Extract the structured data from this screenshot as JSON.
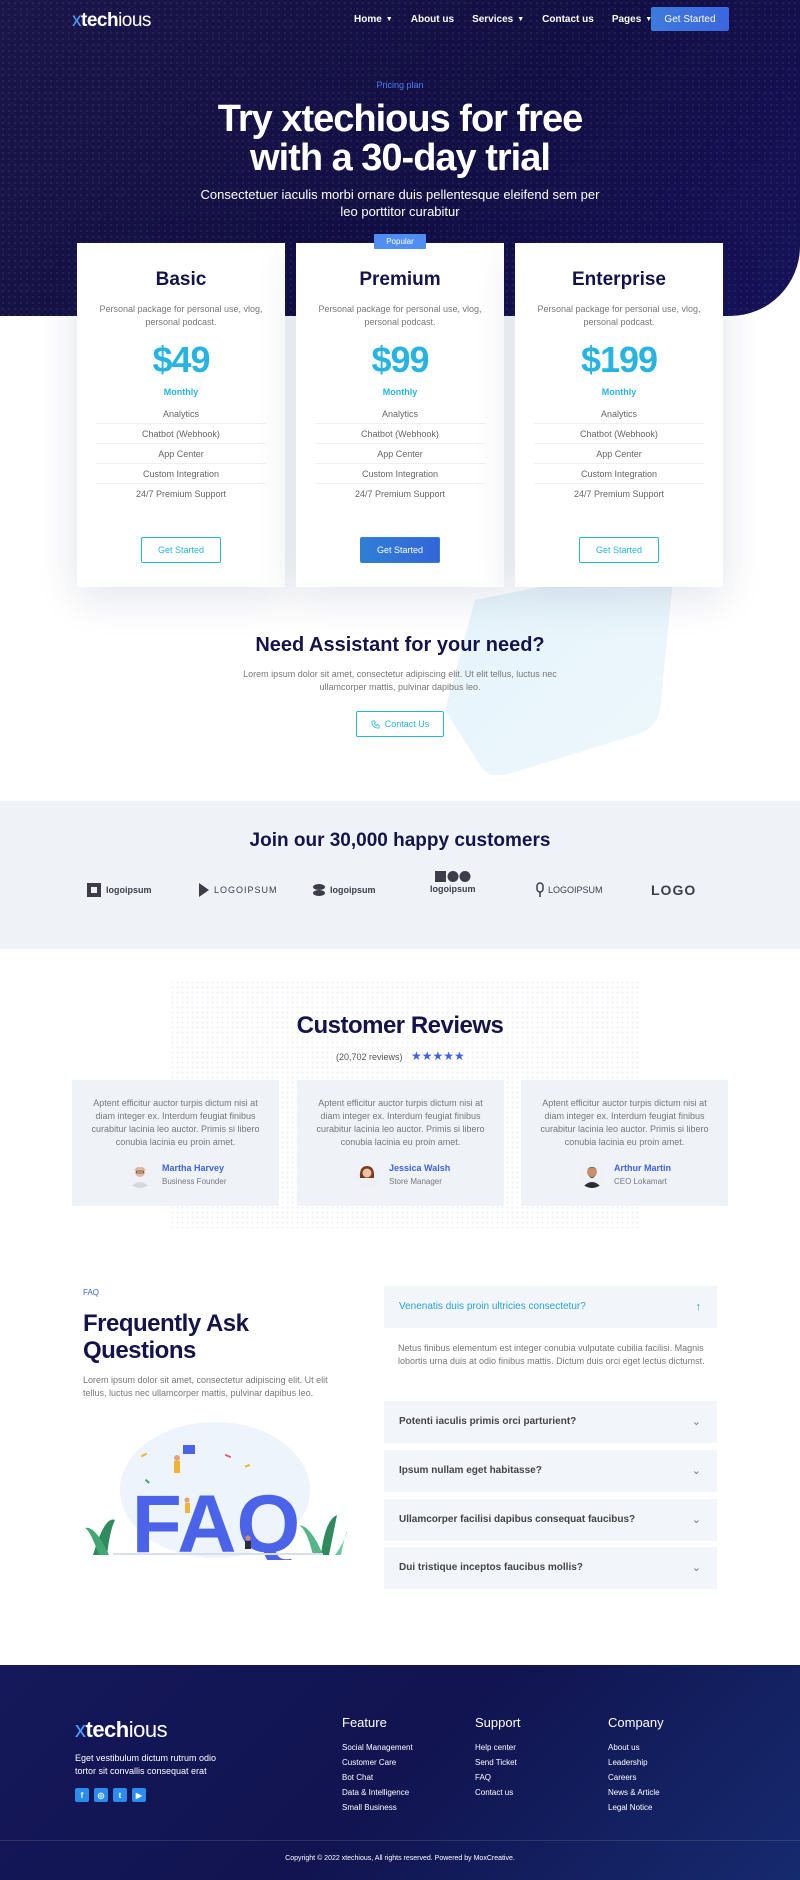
{
  "brand": {
    "x": "x",
    "bold": "tech",
    "regular": "ious"
  },
  "nav": {
    "items": [
      {
        "label": "Home",
        "dropdown": true
      },
      {
        "label": "About us",
        "dropdown": false
      },
      {
        "label": "Services",
        "dropdown": true
      },
      {
        "label": "Contact us",
        "dropdown": false
      },
      {
        "label": "Pages",
        "dropdown": true
      }
    ],
    "cta": "Get Started"
  },
  "hero": {
    "eyebrow": "Pricing plan",
    "title_line1": "Try xtechious for free",
    "title_line2": "with a 30-day trial",
    "subtitle": "Consectetuer iaculis morbi ornare duis pellentesque eleifend sem per leo porttitor curabitur"
  },
  "pricing": {
    "popular_badge": "Popular",
    "plans": [
      {
        "name": "Basic",
        "desc": "Personal package for personal use, vlog, personal podcast.",
        "price": "$49",
        "period": "Monthly",
        "features": [
          "Analytics",
          "Chatbot (Webhook)",
          "App Center",
          "Custom Integration",
          "24/7 Premium Support"
        ],
        "button": "Get Started",
        "highlighted": false
      },
      {
        "name": "Premium",
        "desc": "Personal package for personal use, vlog, personal podcast.",
        "price": "$99",
        "period": "Monthly",
        "features": [
          "Analytics",
          "Chatbot (Webhook)",
          "App Center",
          "Custom Integration",
          "24/7 Premium Support"
        ],
        "button": "Get Started",
        "highlighted": true
      },
      {
        "name": "Enterprise",
        "desc": "Personal package for personal use, vlog, personal podcast.",
        "price": "$199",
        "period": "Monthly",
        "features": [
          "Analytics",
          "Chatbot (Webhook)",
          "App Center",
          "Custom Integration",
          "24/7 Premium Support"
        ],
        "button": "Get Started",
        "highlighted": false
      }
    ]
  },
  "assistant": {
    "title": "Need Assistant for your need?",
    "text": "Lorem ipsum dolor sit amet, consectetur adipiscing elit. Ut elit tellus, luctus nec ullamcorper mattis, pulvinar dapibus leo.",
    "button": "Contact Us"
  },
  "customers": {
    "title": "Join our 30,000 happy customers",
    "logos": [
      "logoipsum",
      "LOGOIPSUM",
      "logoipsum",
      "logoipsum",
      "LOGOIPSUM",
      "LOGO"
    ]
  },
  "reviews": {
    "title": "Customer Reviews",
    "count": "(20,702 reviews)",
    "stars": "★★★★★",
    "items": [
      {
        "text": "Aptent efficitur auctor turpis dictum nisi at diam integer ex. Interdum feugiat finibus curabitur lacinia leo auctor. Primis si libero conubia lacinia eu proin amet.",
        "name": "Martha Harvey",
        "role": "Business Founder"
      },
      {
        "text": "Aptent efficitur auctor turpis dictum nisi at diam integer ex. Interdum feugiat finibus curabitur lacinia leo auctor. Primis si libero conubia lacinia eu proin amet.",
        "name": "Jessica Walsh",
        "role": "Store Manager"
      },
      {
        "text": "Aptent efficitur auctor turpis dictum nisi at diam integer ex. Interdum feugiat finibus curabitur lacinia leo auctor. Primis si libero conubia lacinia eu proin amet.",
        "name": "Arthur Martin",
        "role": "CEO Lokamart"
      }
    ]
  },
  "faq": {
    "eyebrow": "FAQ",
    "title": "Frequently Ask Questions",
    "text": "Lorem ipsum dolor sit amet, consectetur adipiscing elit. Ut elit tellus, luctus nec ullamcorper mattis, pulvinar dapibus leo.",
    "illustration_text": "FAQ",
    "items": [
      {
        "q": "Venenatis duis proin ultricies consectetur?",
        "open": true,
        "a": "Netus finibus elementum est integer conubia vulputate cubilia facilisi. Magnis lobortis urna duis at odio finibus mattis. Dictum duis orci eget lectus dictumst."
      },
      {
        "q": "Potenti iaculis primis orci parturient?",
        "open": false
      },
      {
        "q": "Ipsum nullam eget habitasse?",
        "open": false
      },
      {
        "q": "Ullamcorper facilisi dapibus consequat faucibus?",
        "open": false
      },
      {
        "q": "Dui tristique inceptos faucibus mollis?",
        "open": false
      }
    ]
  },
  "footer": {
    "text": "Eget vestibulum dictum rutrum odio tortor sit convallis consequat erat",
    "social": [
      "f",
      "◎",
      "t",
      "▶"
    ],
    "columns": [
      {
        "title": "Feature",
        "links": [
          "Social Management",
          "Customer Care",
          "Bot Chat",
          "Data & Intelligence",
          "Small Business"
        ]
      },
      {
        "title": "Support",
        "links": [
          "Help center",
          "Send Ticket",
          "FAQ",
          "Contact us"
        ]
      },
      {
        "title": "Company",
        "links": [
          "About us",
          "Leadership",
          "Careers",
          "News & Article",
          "Legal Notice"
        ]
      }
    ],
    "copyright": "Copyright © 2022 xtechious, All rights reserved. Powered by MoxCreative."
  },
  "colors": {
    "navy": "#120f44",
    "accent": "#27b4e2",
    "blue": "#3d62e3"
  }
}
